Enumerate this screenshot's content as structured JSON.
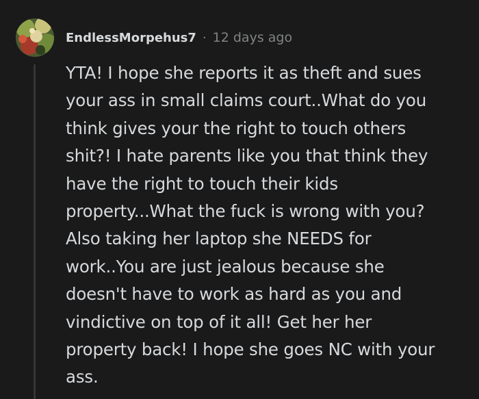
{
  "comment": {
    "username": "EndlessMorpehus7",
    "separator": "·",
    "timestamp": "12 days ago",
    "avatar_icon": "user-avatar-icon",
    "body": "YTA! I hope she reports it as theft and sues\nyour ass in small claims court..What do you\nthink gives your the right to touch others\nshit?! I hate parents like you that think they\nhave the right to touch their kids\nproperty...What the fuck is wrong with you?\nAlso taking her laptop she NEEDS for\nwork..You are just jealous because she\ndoesn't have to work as hard as you and\nvindictive on top of it all! Get her her\nproperty back! I hope she goes NC with your\nass."
  },
  "colors": {
    "background": "#1a1a1b",
    "text": "#d7dadc",
    "muted": "#818384",
    "thread_line": "#343536"
  }
}
